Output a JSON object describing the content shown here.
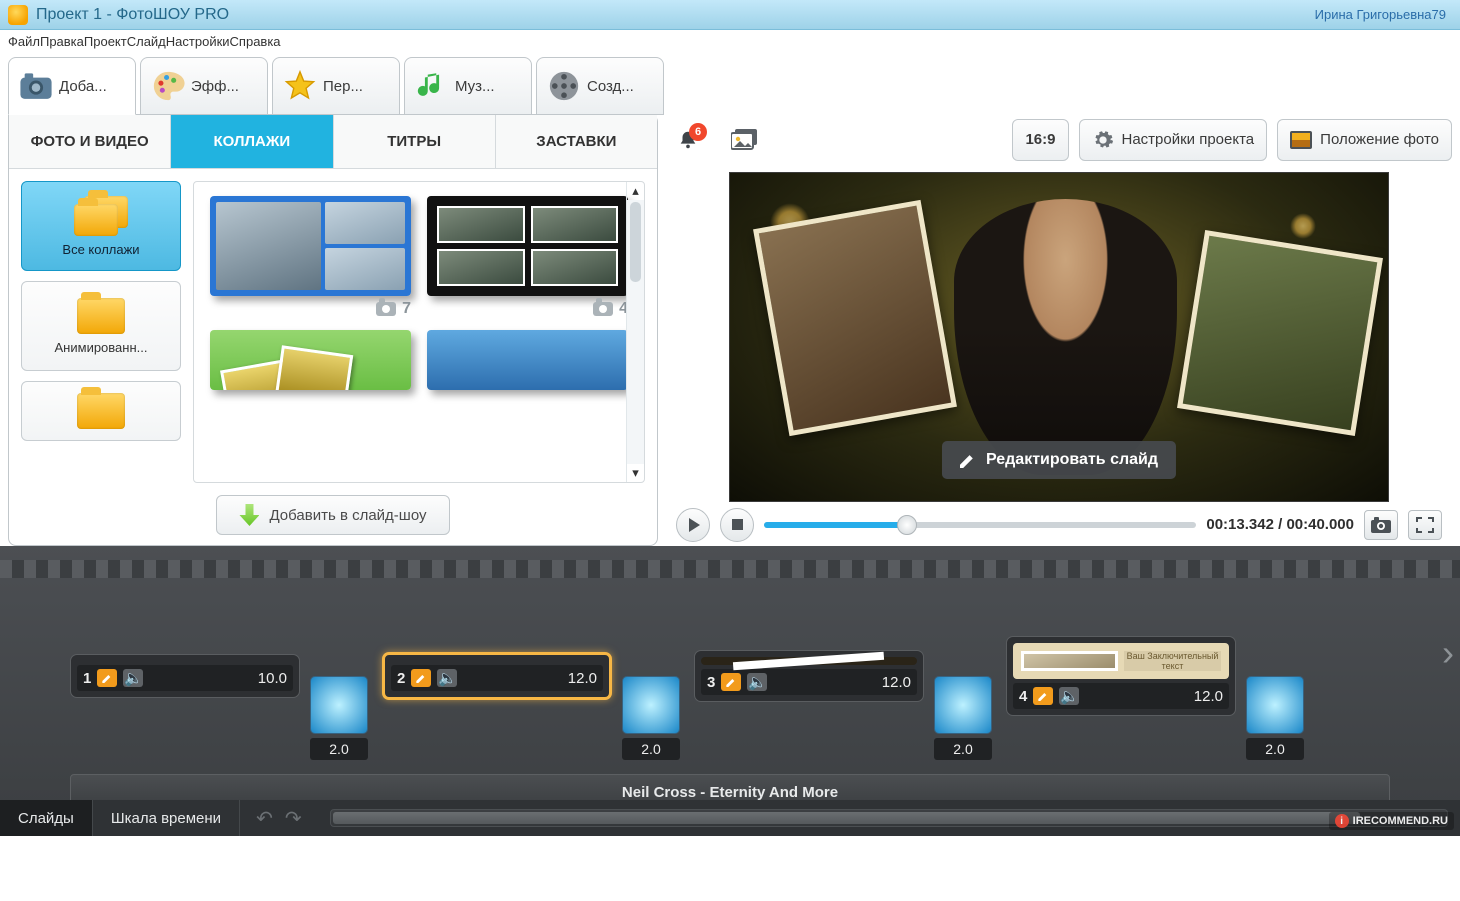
{
  "window": {
    "title": "Проект 1 - ФотоШОУ PRO",
    "user": "Ирина Григорьевна79"
  },
  "menu": {
    "file": "Файл",
    "edit": "Правка",
    "project": "Проект",
    "slide": "Слайд",
    "settings": "Настройки",
    "help": "Справка"
  },
  "mainTabs": {
    "add": "Доба...",
    "effects": "Эфф...",
    "transitions": "Пер...",
    "music": "Муз...",
    "create": "Созд..."
  },
  "notify": {
    "count": "6"
  },
  "aspect": {
    "ratio": "16:9"
  },
  "projectSettings": {
    "label": "Настройки проекта"
  },
  "photoPosition": {
    "label": "Положение фото"
  },
  "subTabs": {
    "photovideo": "ФОТО И ВИДЕО",
    "collages": "КОЛЛАЖИ",
    "titles": "ТИТРЫ",
    "screensavers": "ЗАСТАВКИ"
  },
  "categories": {
    "all": "Все коллажи",
    "animated": "Анимированн..."
  },
  "thumbs": {
    "c1": "7",
    "c2": "4"
  },
  "addToShow": {
    "label": "Добавить в слайд-шоу"
  },
  "editSlide": {
    "label": "Редактировать слайд"
  },
  "time": {
    "current": "00:13.342",
    "total": "00:40.000",
    "sep": " / "
  },
  "slide4text": "Ваш Заключительный текст",
  "slides": [
    {
      "num": "1",
      "dur": "10.0"
    },
    {
      "num": "2",
      "dur": "12.0"
    },
    {
      "num": "3",
      "dur": "12.0"
    },
    {
      "num": "4",
      "dur": "12.0"
    }
  ],
  "trans": {
    "dur": "2.0"
  },
  "music": {
    "track": "Neil Cross - Eternity And More"
  },
  "bottomTabs": {
    "slides": "Слайды",
    "timeline": "Шкала времени"
  },
  "watermark": {
    "text": "IRECOMMEND.RU"
  }
}
